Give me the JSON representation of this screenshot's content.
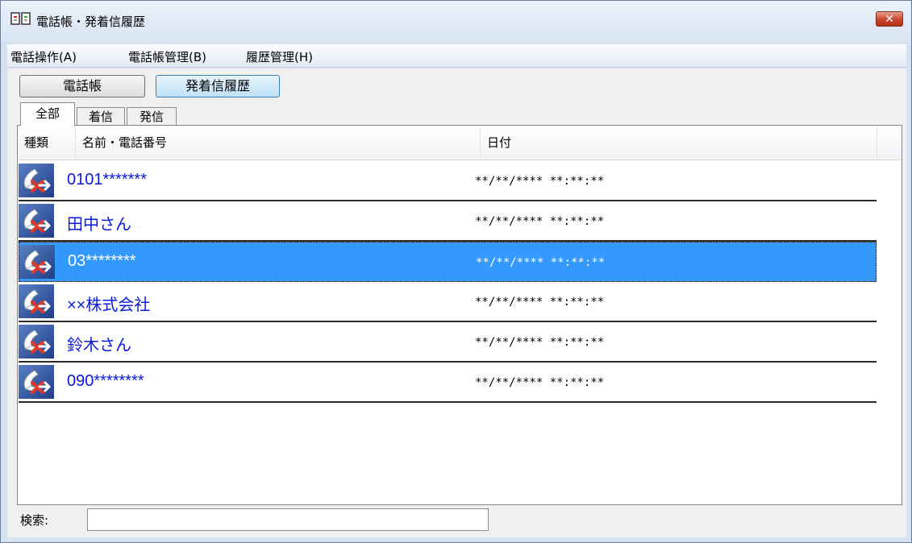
{
  "window": {
    "title": "電話帳・発着信履歴",
    "close_symbol": "✕"
  },
  "menu": [
    {
      "label": "電話操作(A)"
    },
    {
      "label": "電話帳管理(B)"
    },
    {
      "label": "履歴管理(H)"
    }
  ],
  "toolbar": {
    "phonebook_label": "電話帳",
    "history_label": "発着信履歴"
  },
  "tabs": [
    {
      "label": "全部",
      "selected": true
    },
    {
      "label": "着信",
      "selected": false
    },
    {
      "label": "発信",
      "selected": false
    }
  ],
  "columns": {
    "type": "種類",
    "name_phone": "名前・電話番号",
    "date": "日付"
  },
  "rows": [
    {
      "name": "0101*******",
      "date": "**/**/****  **:**:**",
      "selected": false,
      "icon": "outgoing-call-icon"
    },
    {
      "name": "田中さん",
      "date": "**/**/****  **:**:**",
      "selected": false,
      "icon": "outgoing-call-icon"
    },
    {
      "name": "03********",
      "date": "**/**/****  **:**:**",
      "selected": true,
      "icon": "outgoing-call-icon"
    },
    {
      "name": "××株式会社",
      "date": "**/**/****  **:**:**",
      "selected": false,
      "icon": "outgoing-call-icon"
    },
    {
      "name": "鈴木さん",
      "date": "**/**/****  **:**:**",
      "selected": false,
      "icon": "outgoing-call-icon"
    },
    {
      "name": "090********",
      "date": "**/**/****  **:**:**",
      "selected": false,
      "icon": "outgoing-call-icon"
    }
  ],
  "search": {
    "label": "検索:",
    "value": ""
  },
  "colors": {
    "selection": "#3399ff",
    "entry_text": "#0a1adb",
    "close_button": "#c8452b"
  }
}
